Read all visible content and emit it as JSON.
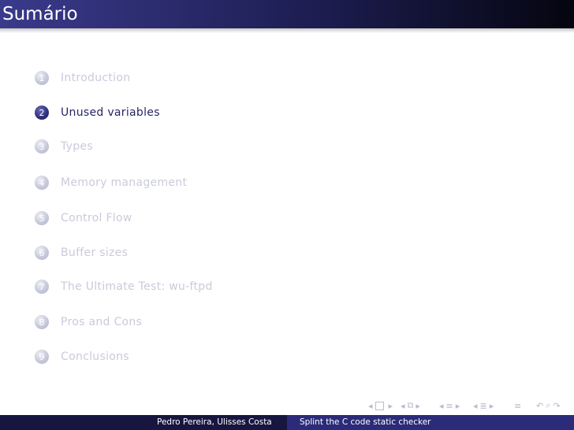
{
  "slide": {
    "title": "Sumário"
  },
  "toc": [
    {
      "number": "1",
      "label": "Introduction",
      "active": false
    },
    {
      "number": "2",
      "label": "Unused variables",
      "active": true
    },
    {
      "number": "3",
      "label": "Types",
      "active": false
    },
    {
      "number": "4",
      "label": "Memory management",
      "active": false
    },
    {
      "number": "5",
      "label": "Control Flow",
      "active": false
    },
    {
      "number": "6",
      "label": "Buffer sizes",
      "active": false
    },
    {
      "number": "7",
      "label": "The Ultimate Test: wu-ftpd",
      "active": false
    },
    {
      "number": "8",
      "label": "Pros and Cons",
      "active": false
    },
    {
      "number": "9",
      "label": "Conclusions",
      "active": false
    }
  ],
  "footer": {
    "authors": "Pedro Pereira, Ulisses Costa",
    "talk_title": "Splint the C code static checker"
  },
  "colors": {
    "title_bar": "#2a2a6e",
    "active": "#262664",
    "inactive": "#c9cbdb",
    "footer_left": "#161640",
    "footer_right": "#2b2b7a"
  }
}
